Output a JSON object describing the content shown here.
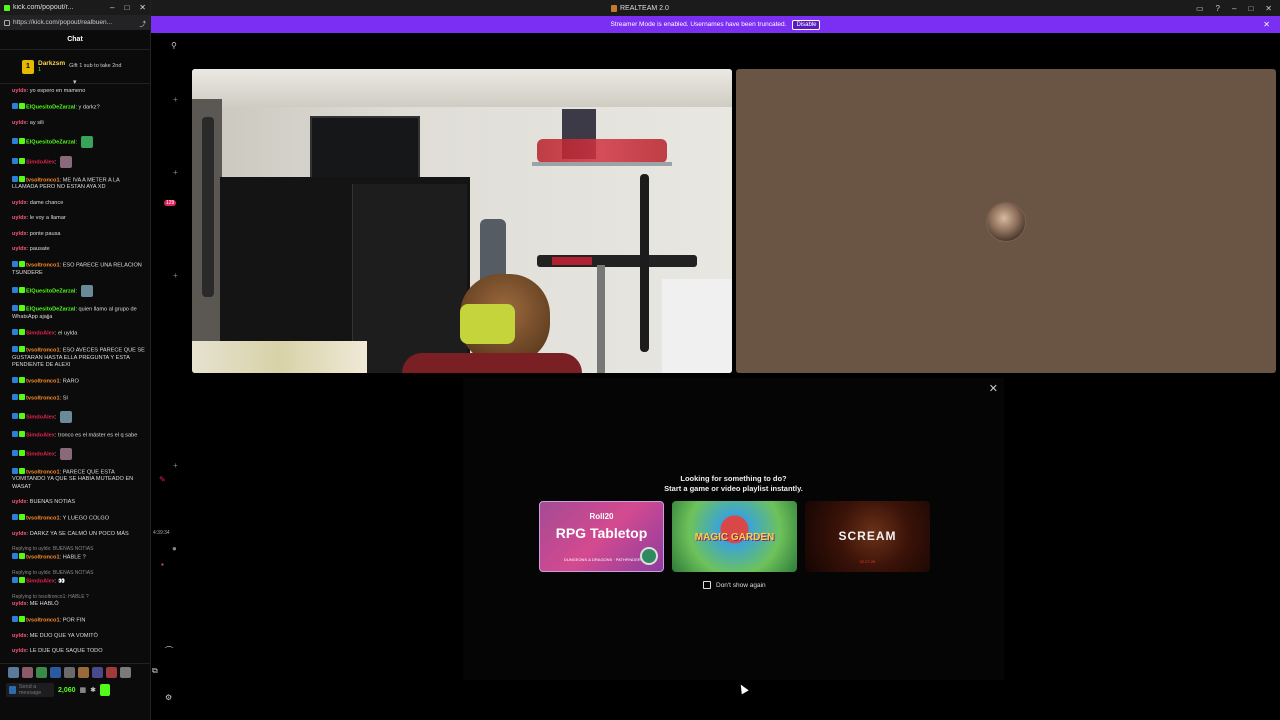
{
  "chat_window": {
    "tab_title": "kick.com/popout/r...",
    "url": "https://kick.com/popout/realbuen...",
    "header": "Chat",
    "pinned": {
      "user": "Darkzsm",
      "sub_badge": "1",
      "gift_text": "Gift 1 sub to take 2nd"
    },
    "messages": [
      {
        "user": "uyldx",
        "color": "#ff5a7a",
        "text": "yo espero en mameno"
      },
      {
        "user": "ElQuesitoDeZarzal",
        "color": "#53fc18",
        "text": "y darkz?"
      },
      {
        "user": "uyldx",
        "color": "#ff5a7a",
        "text": "ay sili"
      },
      {
        "user": "ElQuesitoDeZarzal",
        "color": "#53fc18",
        "text": ""
      },
      {
        "user": "SimdoAlex",
        "color": "#e0244a",
        "text": ""
      },
      {
        "user": "tvsoltronco1",
        "color": "#ff8c2a",
        "text": "ME IVA A METER A LA LLAMADA PERO NO ESTAN AYA XD"
      },
      {
        "user": "uyldx",
        "color": "#ff5a7a",
        "text": "dame chance"
      },
      {
        "user": "uyldx",
        "color": "#ff5a7a",
        "text": "le voy a llamar"
      },
      {
        "user": "uyldx",
        "color": "#ff5a7a",
        "text": "ponte pausa"
      },
      {
        "user": "uyldx",
        "color": "#ff5a7a",
        "text": "pausate"
      },
      {
        "user": "tvsoltronco1",
        "color": "#ff8c2a",
        "text": "ESO PARECE UNA RELACION TSUNDERE"
      },
      {
        "user": "ElQuesitoDeZarzal",
        "color": "#53fc18",
        "text": ""
      },
      {
        "user": "ElQuesitoDeZarzal",
        "color": "#53fc18",
        "text": "quien llamo al grupo de WhatsApp ajajja"
      },
      {
        "user": "SimdoAlex",
        "color": "#e0244a",
        "text": "el uylda"
      },
      {
        "user": "tvsoltronco1",
        "color": "#ff8c2a",
        "text": "ESO AVECES PARECE QUE SE GUSTARAN HASTA ELLA PREGUNTA Y ESTA PENDIENTE DE ALEXI"
      },
      {
        "user": "tvsoltronco1",
        "color": "#ff8c2a",
        "text": "RARO"
      },
      {
        "user": "tvsoltronco1",
        "color": "#ff8c2a",
        "text": "SI"
      },
      {
        "user": "SimdoAlex",
        "color": "#e0244a",
        "text": ""
      },
      {
        "user": "SimdoAlex",
        "color": "#e0244a",
        "text": "tronco es el máster es el q sabe"
      },
      {
        "user": "SimdoAlex",
        "color": "#e0244a",
        "text": ""
      },
      {
        "user": "tvsoltronco1",
        "color": "#ff8c2a",
        "text": "PARECE QUE ESTA VOMITANDO YA QUE SE HABIA MUTEADO EN WASAT"
      },
      {
        "user": "uyldx",
        "color": "#ff5a7a",
        "text": "BUENAS NOTIAS"
      },
      {
        "user": "tvsoltronco1",
        "color": "#ff8c2a",
        "text": "Y LUEGO COLGO"
      },
      {
        "user": "uyldx",
        "color": "#ff5a7a",
        "text": "DARKZ YA SE CALMÓ UN POCO MÁS"
      },
      {
        "reply": "Replying to uyldx: BUENAS NOTIAS",
        "user": "tvsoltronco1",
        "color": "#ff8c2a",
        "text": "HABLE ?"
      },
      {
        "reply": "Replying to uyldx: BUENAS NOTIAS",
        "user": "SimdoAlex",
        "color": "#e0244a",
        "text": "👀"
      },
      {
        "reply": "Replying to tvsoltronco1: HABLE ?",
        "user": "uyldx",
        "color": "#ff5a7a",
        "text": "ME HABLÓ"
      },
      {
        "user": "tvsoltronco1",
        "color": "#ff8c2a",
        "text": "POR FIN"
      },
      {
        "user": "uyldx",
        "color": "#ff5a7a",
        "text": "ME DIJO QUE YA VOMITÓ"
      },
      {
        "user": "uyldx",
        "color": "#ff5a7a",
        "text": "LE DIJE QUE SAQUE TODO"
      }
    ],
    "input_placeholder": "Send a message",
    "points": "2,060"
  },
  "rail": {
    "badge": "129",
    "time": "4:39:34"
  },
  "app": {
    "title": "REALTEAM 2.0",
    "banner_text": "Streamer Mode is enabled. Usernames have been truncated.",
    "banner_button": "Disable"
  },
  "activity": {
    "line1": "Looking for something to do?",
    "line2": "Start a game or video playlist instantly.",
    "tiles": [
      {
        "brand": "Roll20",
        "name": "RPG Tabletop",
        "sub": "DUNGEONS & DRAGONS · PATHFINDER"
      },
      {
        "name": "MAGIC GARDEN"
      },
      {
        "name": "SCREAM",
        "date": "02.27.26"
      }
    ],
    "checkbox_label": "Don't show again"
  }
}
